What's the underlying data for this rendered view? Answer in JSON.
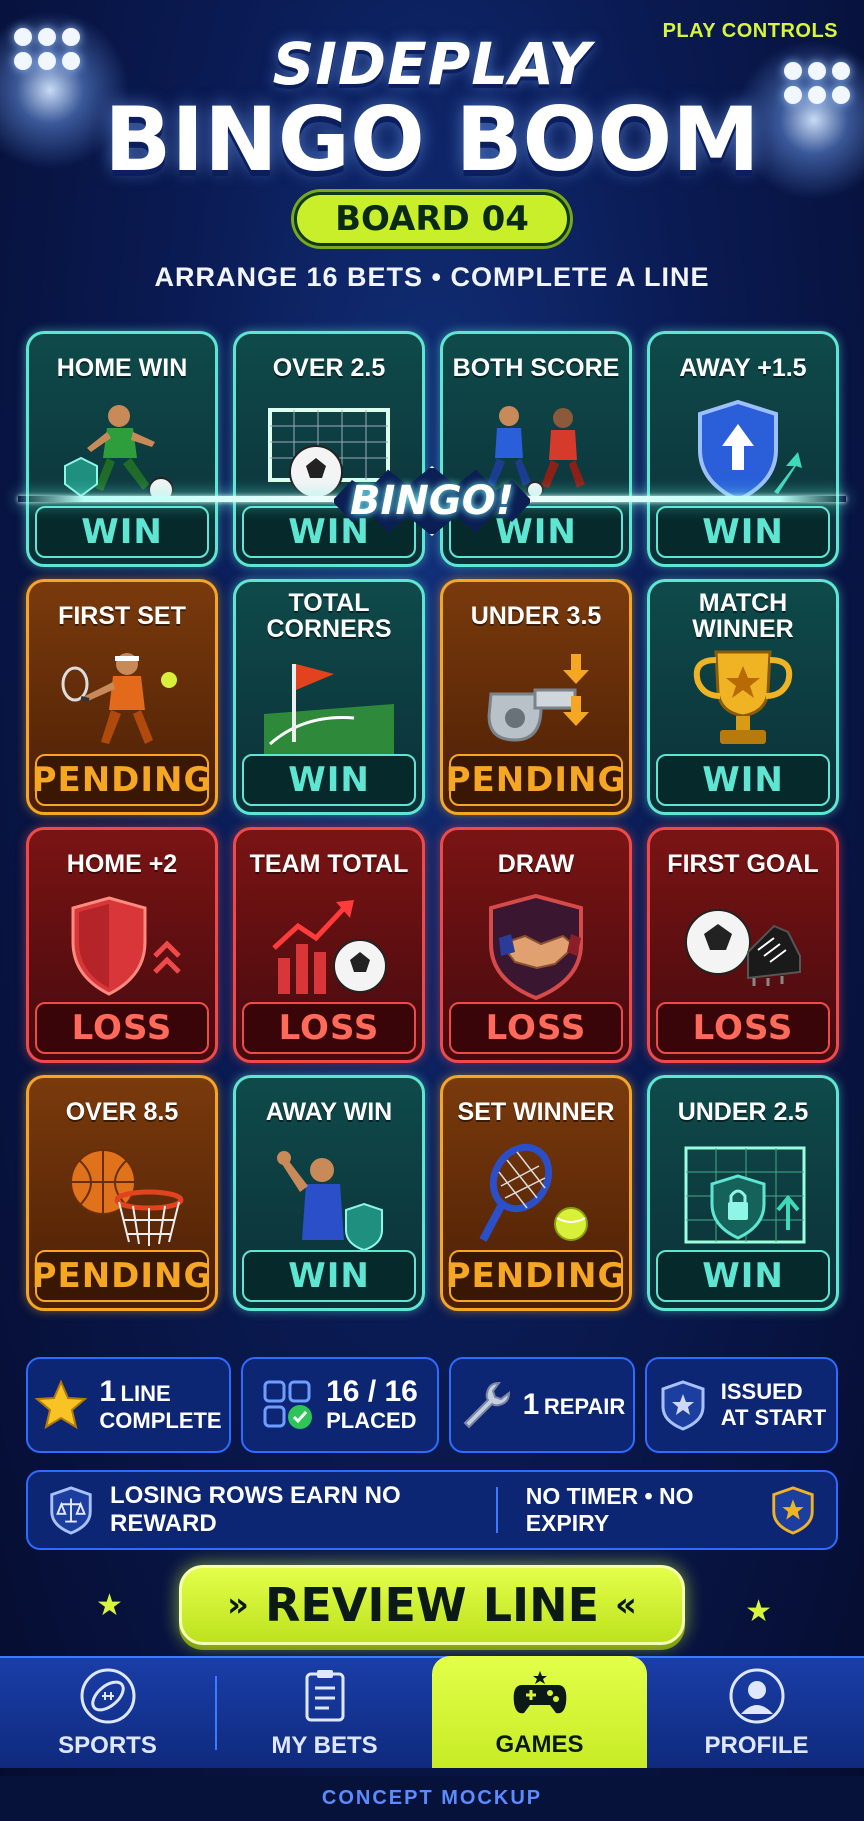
{
  "header": {
    "top_link": "PLAY CONTROLS",
    "title_line1": "SIDEPLAY",
    "title_line2": "BINGO BOOM",
    "board_label": "BOARD 04",
    "subtitle": "ARRANGE 16 BETS • COMPLETE A LINE"
  },
  "bingo_callout": "BINGO!",
  "tiles": [
    {
      "label": "HOME WIN",
      "status": "WIN",
      "state": "win",
      "icon": "soccer-player-icon"
    },
    {
      "label": "OVER 2.5",
      "status": "WIN",
      "state": "win",
      "icon": "soccer-goal-icon"
    },
    {
      "label": "BOTH SCORE",
      "status": "WIN",
      "state": "win",
      "icon": "two-players-icon"
    },
    {
      "label": "AWAY +1.5",
      "status": "WIN",
      "state": "win",
      "icon": "shield-arrow-icon"
    },
    {
      "label": "FIRST SET",
      "status": "PENDING",
      "state": "pending",
      "icon": "tennis-player-icon"
    },
    {
      "label": "TOTAL CORNERS",
      "status": "WIN",
      "state": "win",
      "icon": "corner-flag-icon"
    },
    {
      "label": "UNDER 3.5",
      "status": "PENDING",
      "state": "pending",
      "icon": "whistle-icon"
    },
    {
      "label": "MATCH WINNER",
      "status": "WIN",
      "state": "win",
      "icon": "trophy-icon"
    },
    {
      "label": "HOME +2",
      "status": "LOSS",
      "state": "loss",
      "icon": "red-shield-icon"
    },
    {
      "label": "TEAM TOTAL",
      "status": "LOSS",
      "state": "loss",
      "icon": "bar-chart-ball-icon"
    },
    {
      "label": "DRAW",
      "status": "LOSS",
      "state": "loss",
      "icon": "handshake-icon"
    },
    {
      "label": "FIRST GOAL",
      "status": "LOSS",
      "state": "loss",
      "icon": "ball-boot-icon"
    },
    {
      "label": "OVER 8.5",
      "status": "PENDING",
      "state": "pending",
      "icon": "basketball-hoop-icon"
    },
    {
      "label": "AWAY WIN",
      "status": "WIN",
      "state": "win",
      "icon": "celebrating-player-icon"
    },
    {
      "label": "SET WINNER",
      "status": "PENDING",
      "state": "pending",
      "icon": "tennis-racket-icon"
    },
    {
      "label": "UNDER 2.5",
      "status": "WIN",
      "state": "win",
      "icon": "goal-lock-icon"
    }
  ],
  "stats": {
    "lines": {
      "value": "1",
      "label1": "LINE",
      "label2": "COMPLETE"
    },
    "placed": {
      "value": "16 / 16",
      "label": "PLACED"
    },
    "repair": {
      "value": "1",
      "label": "REPAIR"
    },
    "issued": {
      "label1": "ISSUED",
      "label2": "AT START"
    }
  },
  "notice": {
    "left": "LOSING ROWS EARN NO REWARD",
    "right": "NO TIMER • NO EXPIRY"
  },
  "review_button": "REVIEW LINE",
  "tabs": [
    {
      "label": "SPORTS"
    },
    {
      "label": "MY BETS"
    },
    {
      "label": "GAMES"
    },
    {
      "label": "PROFILE"
    }
  ],
  "footer": "CONCEPT MOCKUP",
  "colors": {
    "win": "#5fe6d2",
    "pending": "#f5a623",
    "loss": "#ef4a4a",
    "accent": "#d6f53b"
  }
}
